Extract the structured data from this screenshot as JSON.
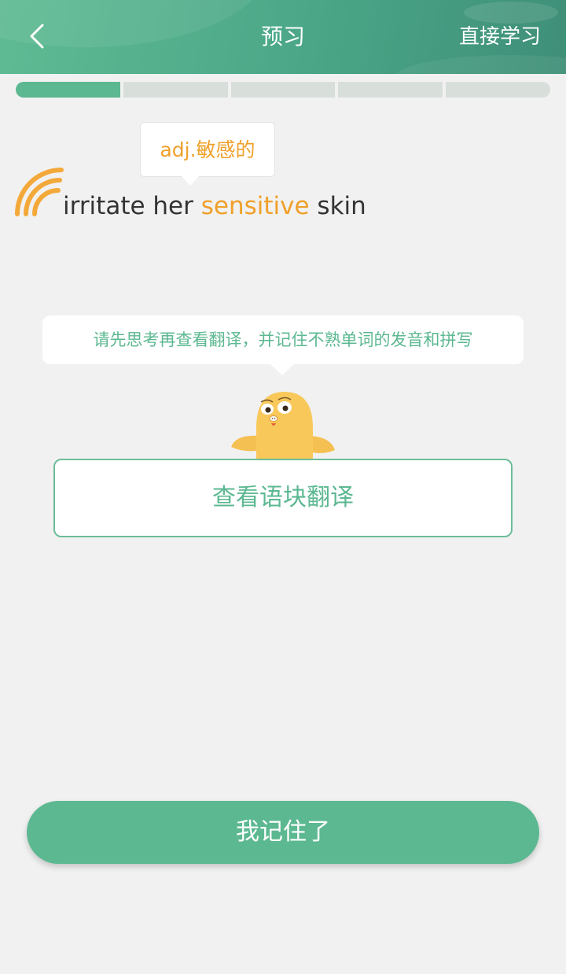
{
  "header": {
    "title": "预习",
    "skip_label": "直接学习",
    "back_icon": "chevron-left-icon"
  },
  "progress": {
    "total_segments": 5,
    "completed_segments": 1
  },
  "word_tooltip": {
    "text": "adj.敏感的"
  },
  "phrase": {
    "before": "irritate her ",
    "highlight": "sensitive",
    "after": " skin",
    "sound_icon": "audio-waves-icon"
  },
  "hint": {
    "text": "请先思考再查看翻译，并记住不熟单词的发音和拼写"
  },
  "translate_button": {
    "label": "查看语块翻译"
  },
  "remember_button": {
    "label": "我记住了"
  },
  "colors": {
    "brand_green": "#5cb891",
    "accent_orange": "#f0a02a",
    "mascot_yellow": "#f8c85a",
    "progress_track": "#d8dfdb",
    "background": "#f1f1f1"
  }
}
